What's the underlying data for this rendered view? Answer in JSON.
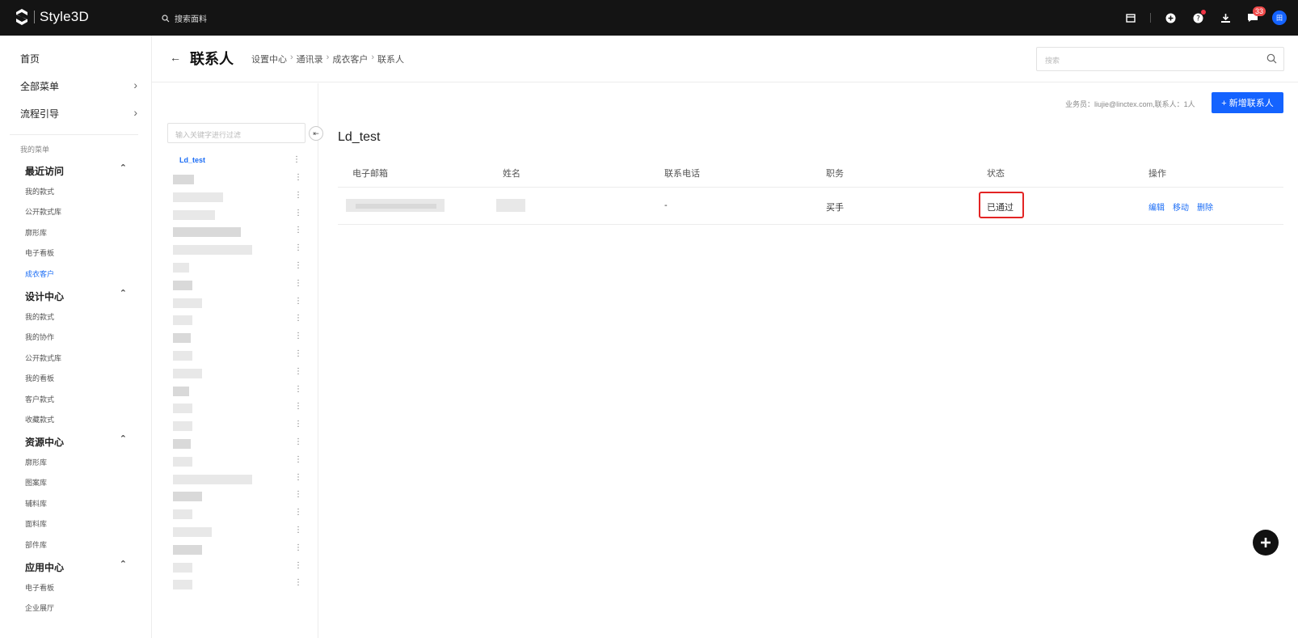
{
  "app": {
    "brand": "Style3D"
  },
  "topbar": {
    "search_label": "搜索面料",
    "message_count": "33",
    "avatar_text": "田"
  },
  "sidebar": {
    "top_items": [
      {
        "label": "首页"
      },
      {
        "label": "全部菜单"
      },
      {
        "label": "流程引导"
      }
    ],
    "section_label": "我的菜单",
    "groups": [
      {
        "label": "最近访问",
        "items": [
          "我的款式",
          "公开款式库",
          "廓形库",
          "电子看板",
          "成衣客户"
        ]
      },
      {
        "label": "设计中心",
        "items": [
          "我的款式",
          "我的协作",
          "公开款式库",
          "我的看板",
          "客户款式",
          "收藏款式"
        ]
      },
      {
        "label": "资源中心",
        "items": [
          "廓形库",
          "图案库",
          "辅料库",
          "面料库",
          "部件库"
        ]
      },
      {
        "label": "应用中心",
        "items": [
          "电子看板",
          "企业展厅"
        ]
      }
    ],
    "active_item": "成衣客户"
  },
  "header": {
    "title": "联系人",
    "breadcrumb": [
      "设置中心",
      "通讯录",
      "成衣客户",
      "联系人"
    ],
    "search_placeholder": "搜索"
  },
  "info": {
    "text": "业务员：liujie@linctex.com,联系人：1人",
    "add_button": "+ 新增联系人"
  },
  "tree": {
    "filter_placeholder": "输入关键字进行过滤",
    "selected_node": "Ld_test"
  },
  "content": {
    "group_title": "Ld_test",
    "columns": [
      "电子邮箱",
      "姓名",
      "联系电话",
      "职务",
      "状态",
      "操作"
    ],
    "rows": [
      {
        "phone": "-",
        "position": "买手",
        "status": "已通过",
        "actions": [
          "编辑",
          "移动",
          "删除"
        ]
      }
    ]
  },
  "colors": {
    "accent": "#1463ff",
    "topbar": "#141414",
    "highlight": "#e32424"
  }
}
